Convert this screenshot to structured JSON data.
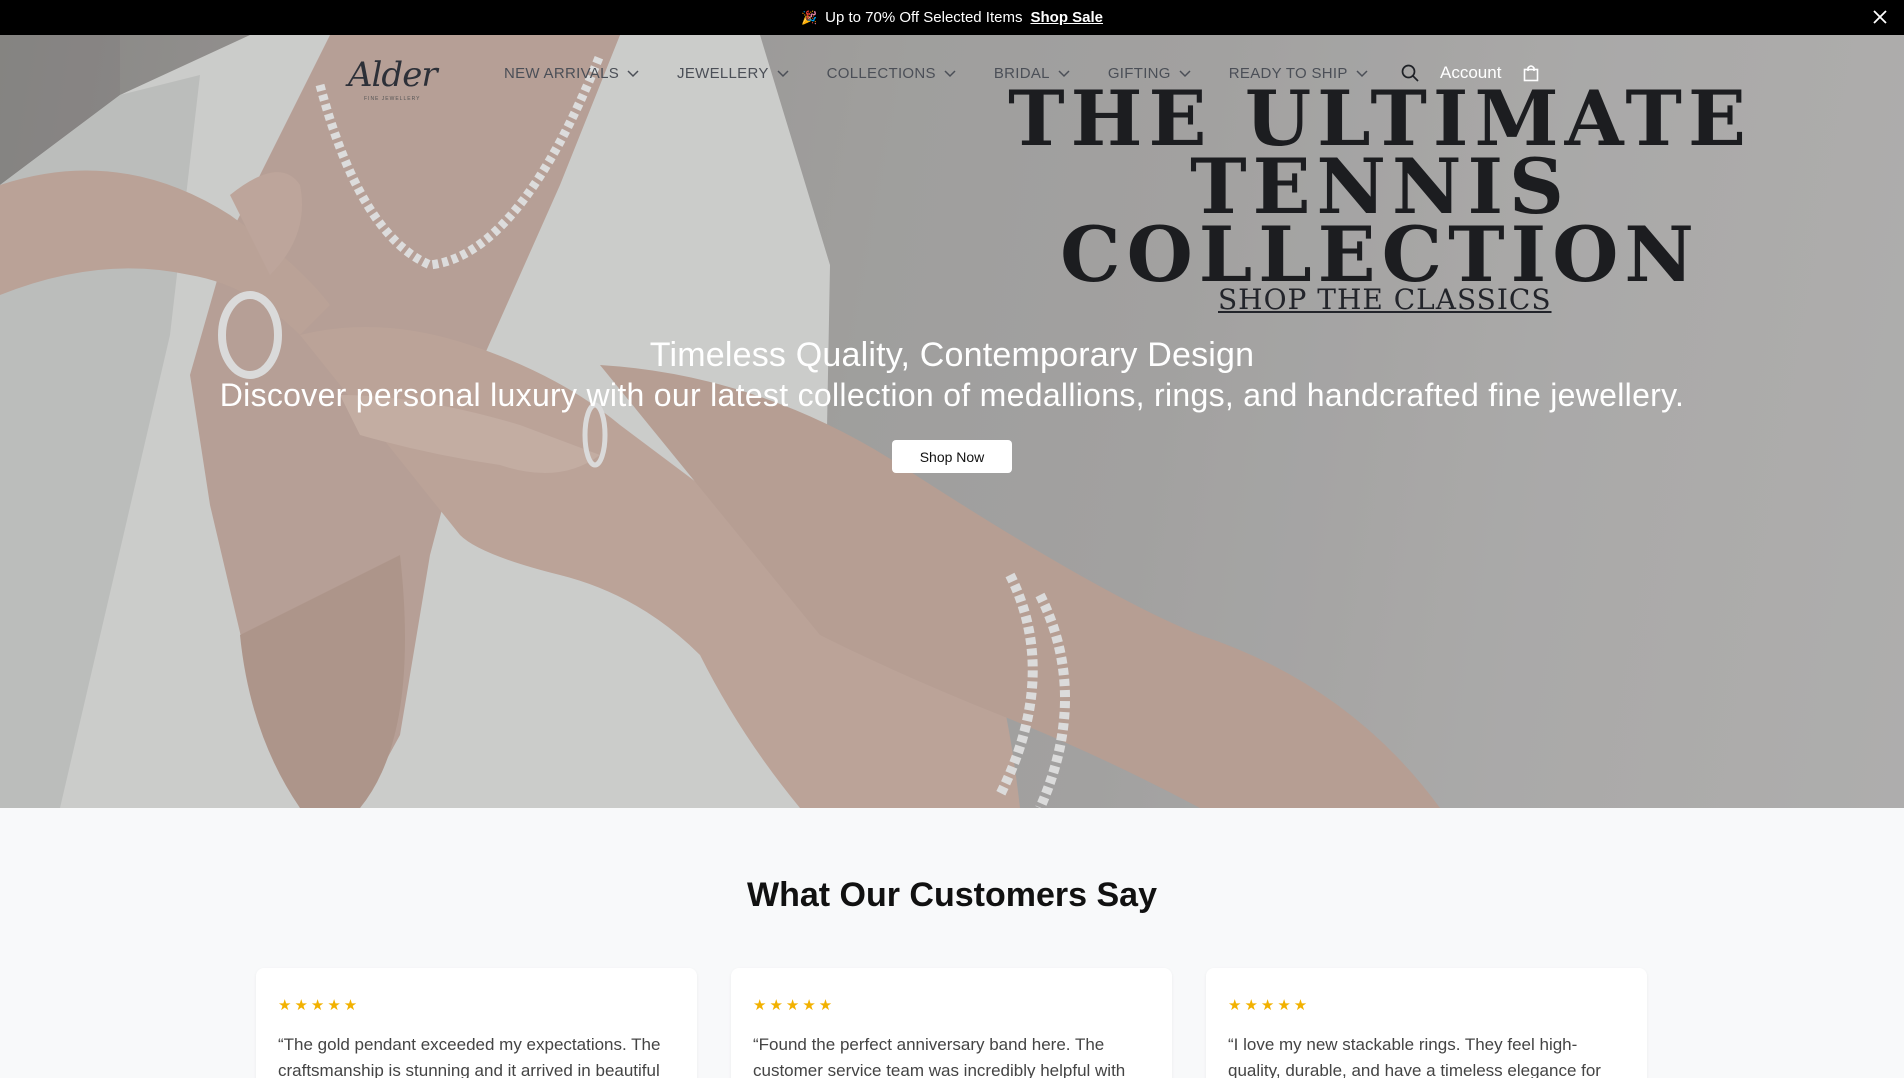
{
  "announcement": {
    "emoji": "🎉",
    "text": "Up to 70% Off Selected Items",
    "link_label": "Shop Sale"
  },
  "nav": {
    "logo": "Alder",
    "logo_sub": "FINE JEWELLERY",
    "items": [
      {
        "label": "NEW ARRIVALS"
      },
      {
        "label": "JEWELLERY"
      },
      {
        "label": "COLLECTIONS"
      },
      {
        "label": "BRIDAL"
      },
      {
        "label": "GIFTING"
      },
      {
        "label": "READY TO SHIP"
      }
    ],
    "account_label": "Account"
  },
  "hero": {
    "headline_line1": "THE ULTIMATE",
    "headline_line2": "TENNIS COLLECTION",
    "headline_link": "SHOP THE CLASSICS",
    "tagline": "Timeless Quality, Contemporary Design",
    "subline": "Discover personal luxury with our latest collection of medallions, rings, and handcrafted fine jewellery.",
    "cta_label": "Shop Now"
  },
  "testimonials": {
    "title": "What Our Customers Say",
    "cards": [
      {
        "stars": "★★★★★",
        "rating": 5,
        "quote": "“The gold pendant exceeded my expectations. The craftsmanship is stunning and it arrived in beautiful"
      },
      {
        "stars": "★★★★★",
        "rating": 5,
        "quote": "“Found the perfect anniversary band here. The customer service team was incredibly helpful with"
      },
      {
        "stars": "★★★★★",
        "rating": 5,
        "quote": "“I love my new stackable rings. They feel high-quality, durable, and have a timeless elegance for"
      }
    ]
  },
  "colors": {
    "announcement_bg": "#000000",
    "star": "#f2b100",
    "page_bg": "#f8f9fa"
  }
}
